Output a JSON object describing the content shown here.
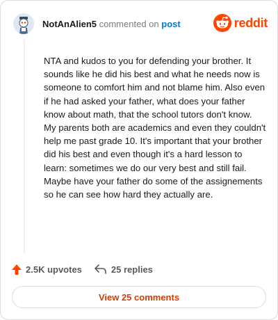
{
  "header": {
    "username": "NotAnAlien5",
    "action_text": "commented on",
    "post_link": "post"
  },
  "brand": {
    "wordmark": "reddit",
    "brand_color": "#ff4500",
    "icon": "reddit-snoo-icon"
  },
  "comment": {
    "body": "NTA and kudos to you for defending your brother. It sounds like he did his best and what he needs now is someone to comfort him and not blame him. Also even if he had asked your father, what does your father know about math, that the school tutors don't know. My parents both are academics and even they couldn't help me past grade 10. It's important that your brother did his best and even though it's a hard lesson to learn: sometimes we do our very best and still fail. Maybe have your father do some of the assignements so he can see how hard they actually are."
  },
  "actions": {
    "upvotes": "2.5K upvotes",
    "upvote_icon": "upvote-arrow-icon",
    "replies": "25 replies",
    "reply_icon": "reply-arrow-icon"
  },
  "view_comments_label": "View 25 comments",
  "colors": {
    "accent_orange": "#ff4500",
    "link_blue": "#0079d3",
    "button_text": "#d93a00"
  }
}
